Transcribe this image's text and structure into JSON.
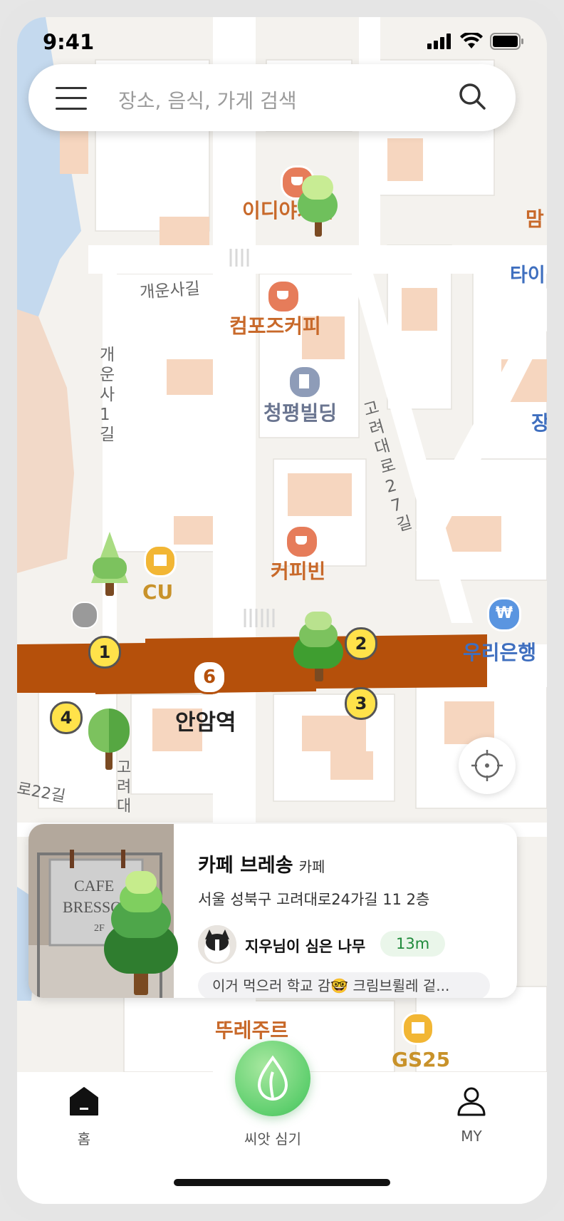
{
  "status_bar": {
    "time": "9:41"
  },
  "search": {
    "placeholder": "장소, 음식, 가게 검색",
    "menu_icon": "hamburger-icon",
    "search_icon": "search-icon"
  },
  "map": {
    "places": [
      {
        "name": "이디야커피",
        "type": "cafe"
      },
      {
        "name": "컴포즈커피",
        "type": "cafe"
      },
      {
        "name": "청평빌딩",
        "type": "building"
      },
      {
        "name": "커피빈",
        "type": "cafe"
      },
      {
        "name": "CU",
        "type": "convenience-store"
      },
      {
        "name": "우리은행",
        "type": "bank"
      },
      {
        "name": "GS25",
        "type": "convenience-store"
      },
      {
        "name": "뚜레주르",
        "type": "bakery"
      }
    ],
    "station": {
      "name": "안암역",
      "line": "6"
    },
    "station_exits": [
      "1",
      "2",
      "3",
      "4"
    ],
    "streets": [
      "개운사길",
      "개운사1길",
      "고려대로27길",
      "고려대",
      "로22길"
    ],
    "edge_labels": [
      "맘",
      "타이",
      "장"
    ]
  },
  "card": {
    "place_name": "카페 브레송",
    "category": "카페",
    "address": "서울 성북구 고려대로24가길 11 2층",
    "planter": "지우님이 심은 나무",
    "distance": "13m",
    "comment": "이거 먹으러 학교 감🤓 크림브륄레 겉...",
    "sign_text": [
      "CAFE",
      "BRESSO",
      "2F"
    ]
  },
  "tabbar": {
    "home": "홈",
    "seed": "씨앗 심기",
    "my": "MY"
  },
  "colors": {
    "accent_green": "#5fcf6e",
    "subway_line": "#b5500b",
    "cafe_marker": "#e67c5a",
    "label_orange": "#c8692a"
  }
}
